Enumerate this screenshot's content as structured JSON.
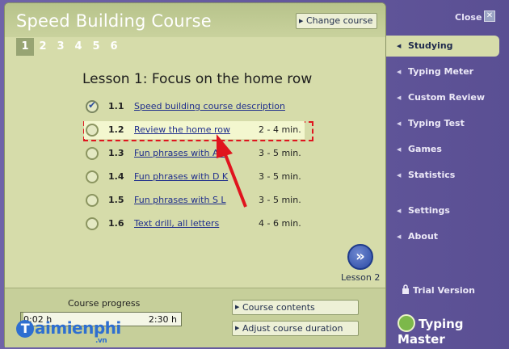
{
  "header": {
    "course_title": "Speed Building Course",
    "change_course_label": "Change course",
    "lesson_numbers": [
      "1",
      "2",
      "3",
      "4",
      "5",
      "6"
    ],
    "active_lesson": "1"
  },
  "lesson": {
    "title": "Lesson 1: Focus on the home row",
    "items": [
      {
        "num": "1.1",
        "label": "Speed building course description",
        "duration": "",
        "checked": true
      },
      {
        "num": "1.2",
        "label": "Review the home row",
        "duration": "2 - 4 min.",
        "checked": false
      },
      {
        "num": "1.3",
        "label": "Fun phrases with A L",
        "duration": "3 - 5 min.",
        "checked": false
      },
      {
        "num": "1.4",
        "label": "Fun phrases with D K",
        "duration": "3 - 5 min.",
        "checked": false
      },
      {
        "num": "1.5",
        "label": "Fun phrases with S L",
        "duration": "3 - 5 min.",
        "checked": false
      },
      {
        "num": "1.6",
        "label": "Text drill, all letters",
        "duration": "4 - 6 min.",
        "checked": false
      }
    ],
    "next_label": "Lesson 2"
  },
  "progress": {
    "label": "Course progress",
    "start": "0:02 h",
    "end": "2:30 h",
    "fraction": 0.013
  },
  "buttons": {
    "course_contents": "Course contents",
    "adjust_duration": "Adjust course duration"
  },
  "sidebar": {
    "close_label": "Close",
    "items": [
      {
        "label": "Studying",
        "active": true
      },
      {
        "label": "Typing Meter",
        "active": false
      },
      {
        "label": "Custom Review",
        "active": false
      },
      {
        "label": "Typing Test",
        "active": false
      },
      {
        "label": "Games",
        "active": false
      },
      {
        "label": "Statistics",
        "active": false
      },
      {
        "label": "Settings",
        "active": false
      },
      {
        "label": "About",
        "active": false
      }
    ],
    "trial_label": "Trial Version",
    "brand_label": "Typing Master"
  },
  "watermark": {
    "text": "aimienphi",
    "suffix": ".vn"
  }
}
